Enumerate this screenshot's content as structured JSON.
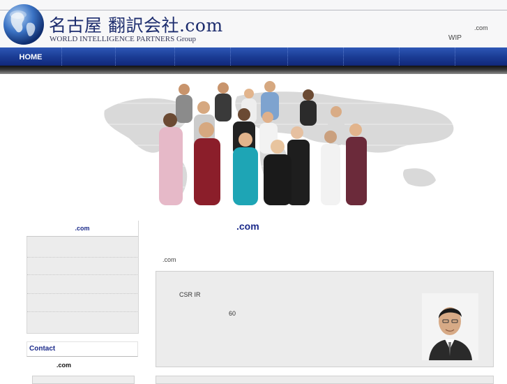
{
  "header": {
    "title": "名古屋 翻訳会社.com",
    "subtitle": "WORLD INTELLIGENCE PARTNERS Group",
    "right_com": ".com",
    "right_wip": "WIP"
  },
  "nav": {
    "items": [
      {
        "label": "HOME"
      }
    ]
  },
  "sidebar": {
    "menu_title": ".com",
    "contact_label": "Contact",
    "contact_text": ".com"
  },
  "main": {
    "title": ".com",
    "intro": ".com",
    "box_line1": "CSR  IR",
    "box_line2": "60"
  },
  "colors": {
    "nav_blue": "#1b3d95",
    "title_blue": "#1b2a8a",
    "panel_gray": "#ececec"
  }
}
